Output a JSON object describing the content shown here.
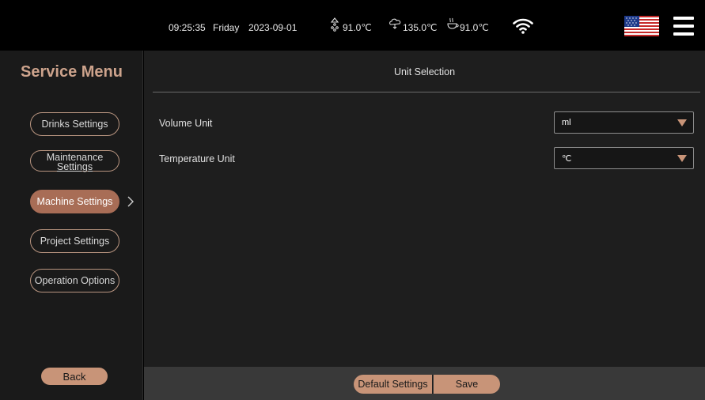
{
  "status": {
    "time": "09:25:35",
    "day": "Friday",
    "date": "2023-09-01",
    "temp1_icon": "boiler-icon",
    "temp1": "91.0℃",
    "temp2_icon": "steam-icon",
    "temp2": "135.0℃",
    "temp3_icon": "cup-heater-icon",
    "temp3": "91.0℃",
    "wifi_icon": "wifi-icon",
    "flag_icon": "us-flag-icon",
    "menu_icon": "hamburger-menu-icon"
  },
  "sidebar": {
    "title": "Service Menu",
    "items": [
      {
        "label": "Drinks Settings",
        "active": false
      },
      {
        "label_line1": "Maintenance",
        "label_line2": "Settings",
        "active": false
      },
      {
        "label": "Machine Settings",
        "active": true
      },
      {
        "label": "Project Settings",
        "active": false
      },
      {
        "label": "Operation Options",
        "active": false
      }
    ],
    "back_label": "Back"
  },
  "main": {
    "title": "Unit Selection",
    "rows": [
      {
        "label": "Volume Unit",
        "value": "ml"
      },
      {
        "label": "Temperature Unit",
        "value": "℃"
      }
    ]
  },
  "footer": {
    "default_label": "Default Settings",
    "save_label": "Save"
  },
  "colors": {
    "accent": "#c89478",
    "active": "#a86d56",
    "title": "#cda38c"
  }
}
